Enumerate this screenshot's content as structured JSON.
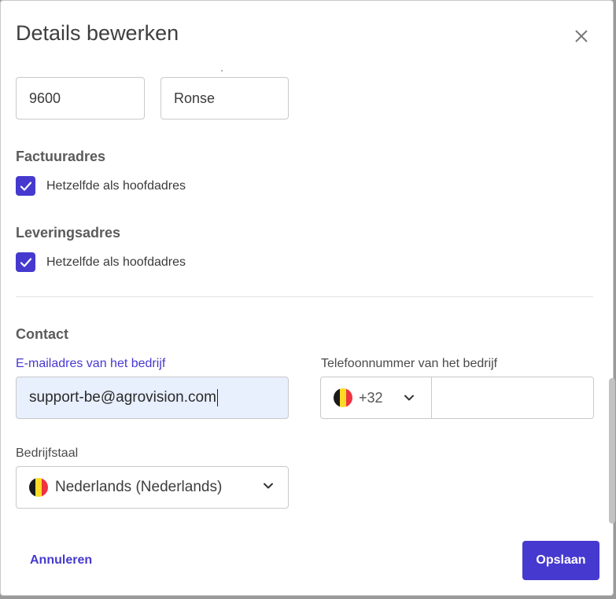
{
  "dialog": {
    "title": "Details bewerken",
    "close_icon": "close-icon"
  },
  "address": {
    "postal_code": "9600",
    "city": "Ronse"
  },
  "billing": {
    "heading": "Factuuradres",
    "same_as_main_label": "Hetzelfde als hoofdadres",
    "checked": true
  },
  "delivery": {
    "heading": "Leveringsadres",
    "same_as_main_label": "Hetzelfde als hoofdadres",
    "checked": true
  },
  "contact": {
    "heading": "Contact",
    "email_label": "E-mailadres van het bedrijf",
    "email_value": "support-be@agrovision.com",
    "phone_label": "Telefoonnummer van het bedrijf",
    "phone_country_flag": "belgium-flag-icon",
    "phone_country_code": "+32",
    "phone_value": "",
    "language_label": "Bedrijfstaal",
    "language_flag": "belgium-flag-icon",
    "language_value": "Nederlands (Nederlands)"
  },
  "footer": {
    "cancel_label": "Annuleren",
    "save_label": "Opslaan"
  },
  "colors": {
    "accent": "#4639cf",
    "email_bg": "#e8effd",
    "flag_black": "#1a1a1a",
    "flag_yellow": "#fdda24",
    "flag_red": "#ef3340"
  }
}
